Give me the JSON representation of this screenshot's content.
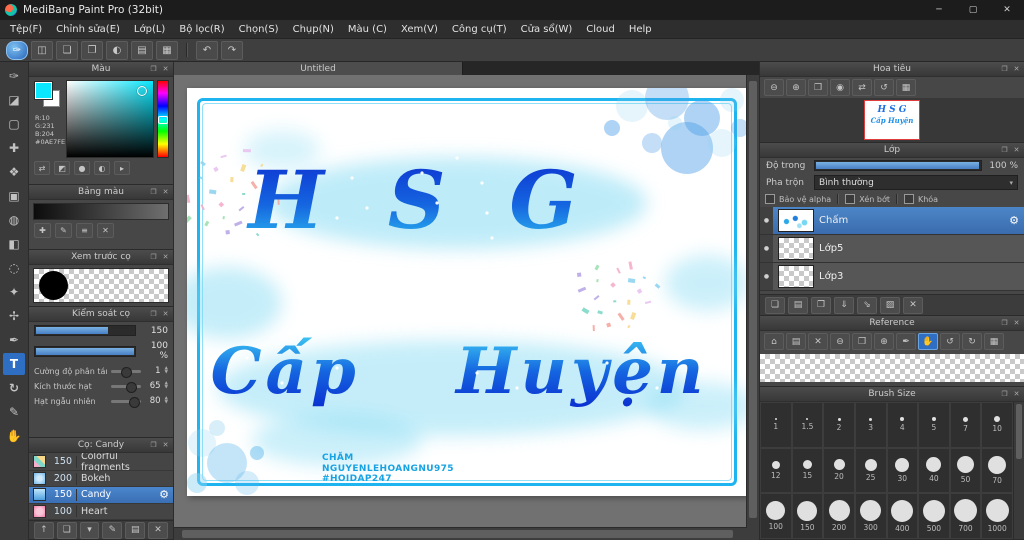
{
  "window": {
    "title": "MediBang Paint Pro (32bit)"
  },
  "ui": {
    "panel_header_icons": [
      "popout-icon",
      "close-icon"
    ],
    "window_controls": [
      "minimize-icon",
      "maximize-icon",
      "close-icon"
    ]
  },
  "menubar": {
    "items": [
      "Tệp(F)",
      "Chỉnh sửa(E)",
      "Lớp(L)",
      "Bộ lọc(R)",
      "Chọn(S)",
      "Chụp(N)",
      "Màu (C)",
      "Xem(V)",
      "Công cụ(T)",
      "Cửa sổ(W)",
      "Cloud",
      "Help"
    ]
  },
  "toolbar": {
    "icons": [
      "brush-select-icon",
      "save-icon",
      "chat-icon",
      "comment-icon",
      "color-window-icon",
      "material-panel-icon",
      "layout-grid-icon"
    ],
    "active": "brush-select-icon",
    "history": [
      "undo-icon",
      "redo-icon"
    ]
  },
  "left_tools": {
    "items": [
      "brush-tool",
      "eraser-tool",
      "select-rect-tool",
      "move-tool",
      "transform-tool",
      "shape-brush-tool",
      "bucket-tool",
      "gradient-tool",
      "select-lasso-tool",
      "magic-wand-tool",
      "snap-tool",
      "eyedropper-tool",
      "text-tool",
      "rotate-canvas-tool",
      "script-brush-tool",
      "pan-tool"
    ],
    "active": "text-tool"
  },
  "canvas": {
    "tab_label": "Untitled",
    "heading": "H S G",
    "subheading": "Cấp Huyện",
    "credits": [
      "CHĂM",
      "NGUYENLEHOANGNU975",
      "#HOIDAP247"
    ],
    "frame_color": "#1db4f0",
    "heading_gradient": [
      "#0c2ecf",
      "#2fc0f0"
    ]
  },
  "panels": {
    "color": {
      "title": "Màu",
      "rgb": {
        "r": "R:10",
        "g": "G:231",
        "b": "B:204",
        "hex": "#0AE7FE"
      },
      "selected_color": "#0AE7FE",
      "footer_icons": [
        "swap-colors-icon",
        "reset-colors-icon",
        "hsv-dot-icon",
        "rgb-dot-icon",
        "menu-arrow-icon"
      ]
    },
    "palette": {
      "title": "Bảng màu",
      "icons": [
        "add-color-icon",
        "edit-color-icon",
        "menu-icon",
        "delete-color-icon"
      ]
    },
    "brush_preview": {
      "title": "Xem trước cọ"
    },
    "brush_control": {
      "title": "Kiểm soát cọ",
      "size_value": "150",
      "opacity_value": "100 %",
      "params": [
        {
          "label": "Cường độ phân tán",
          "value": "1"
        },
        {
          "label": "Kích thước hạt",
          "value": "65"
        },
        {
          "label": "Hạt ngẫu nhiên",
          "value": "80"
        }
      ]
    },
    "brush_list": {
      "title": "Cọ: Candy",
      "items": [
        {
          "size": "150",
          "name": "Colorful fragments"
        },
        {
          "size": "200",
          "name": "Bokeh"
        },
        {
          "size": "150",
          "name": "Candy"
        },
        {
          "size": "100",
          "name": "Heart"
        }
      ],
      "selected_index": 2,
      "footer_icons": [
        "brush-up-icon",
        "new-brush-icon",
        "new-brush-menu-icon",
        "edit-brush-icon",
        "brush-folder-icon",
        "delete-brush-icon"
      ]
    },
    "navigator": {
      "title": "Hoa tiêu",
      "icons": [
        "zoom-out-icon",
        "zoom-in-icon",
        "fit-window-icon",
        "actual-size-icon",
        "flip-horizontal-icon",
        "rotate-reset-icon",
        "grid-icon"
      ]
    },
    "layer": {
      "title": "Lớp",
      "opacity_label": "Độ trong",
      "opacity_value": "100 %",
      "blend_label": "Pha trộn",
      "blend_value": "Bình thường",
      "checkboxes": [
        "Bảo vệ alpha",
        "Xén bớt",
        "Khóa"
      ],
      "layers": [
        {
          "name": "Chấm"
        },
        {
          "name": "Lớp5"
        },
        {
          "name": "Lớp3"
        }
      ],
      "selected_index": 0,
      "footer_icons": [
        "new-layer-icon",
        "new-folder-icon",
        "duplicate-layer-icon",
        "merge-down-icon",
        "transfer-icon",
        "fill-layer-icon",
        "delete-layer-icon"
      ]
    },
    "reference": {
      "title": "Reference",
      "icons": [
        "home-icon",
        "ref-folder-icon",
        "ref-close-icon",
        "ref-zoom-out-icon",
        "ref-fit-icon",
        "ref-zoom-in-icon",
        "ref-eyedropper-icon",
        "hand-icon",
        "rotate-left-icon",
        "rotate-right-icon",
        "ref-grid-icon"
      ],
      "active": "hand-icon"
    },
    "brush_size": {
      "title": "Brush Size",
      "sizes": [
        "1",
        "1.5",
        "2",
        "3",
        "4",
        "5",
        "7",
        "10",
        "12",
        "15",
        "20",
        "25",
        "30",
        "40",
        "50",
        "70",
        "100",
        "150",
        "200",
        "300",
        "400",
        "500",
        "700",
        "1000"
      ]
    }
  },
  "colors": {
    "accent": "#3e7fd2",
    "selected_color": "#0AE7FE"
  }
}
